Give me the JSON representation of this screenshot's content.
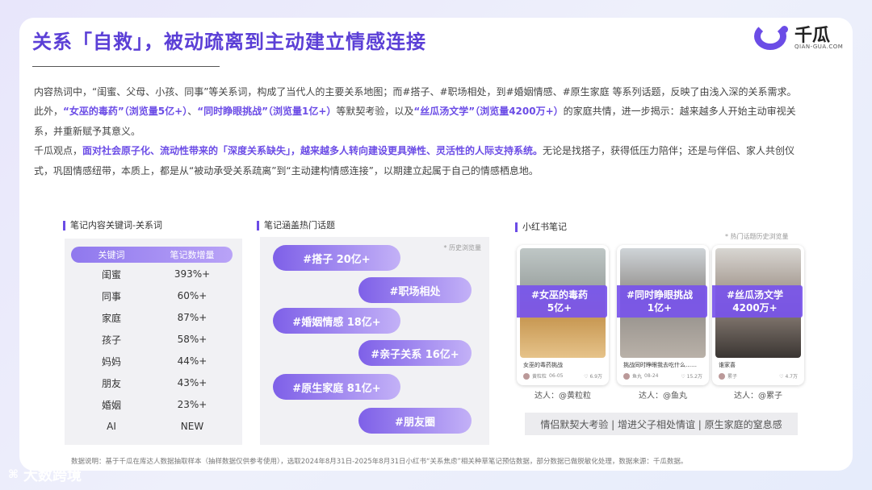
{
  "header": {
    "title": "关系「自救」，被动疏离到主动建立情感连接",
    "brand_name": "千瓜",
    "brand_sub": "QIAN-GUA.COM"
  },
  "intro": {
    "p1_a": "内容热词中，“闺蜜、父母、小孩、同事”等关系词，构成了当代人的主要关系地图；而#搭子、#职场相处，到#婚姻情感、#原生家庭 等系列话题，反映了由浅入深的关系需求。此外，",
    "p1_h1": "“女巫的毒药”（浏览量5亿+）",
    "p1_b": "、",
    "p1_h2": "“同时睁眼挑战”（浏览量1亿+）",
    "p1_c": "等默契考验，以及",
    "p1_h3": "“丝瓜汤文学”（浏览量4200万+）",
    "p1_d": "的家庭共情，进一步揭示：越来越多人开始主动审视关系，并重新赋予其意义。",
    "p2_a": "千瓜观点，",
    "p2_h": "面对社会原子化、流动性带来的「深度关系缺失」，越来越多人转向建设更具弹性、灵活性的人际支持系统。",
    "p2_b": "无论是找搭子，获得低压力陪伴；还是与伴侣、家人共创仪式，巩固情感纽带，本质上，都是从“被动承受关系疏离”到“主动建构情感连接”，以期建立起属于自己的情感栖息地。"
  },
  "keywords": {
    "label": "笔记内容关键词-关系词",
    "col1": "关键词",
    "col2": "笔记数增量",
    "rows": [
      {
        "k": "闺蜜",
        "v": "393%+"
      },
      {
        "k": "同事",
        "v": "60%+"
      },
      {
        "k": "家庭",
        "v": "87%+"
      },
      {
        "k": "孩子",
        "v": "58%+"
      },
      {
        "k": "妈妈",
        "v": "44%+"
      },
      {
        "k": "朋友",
        "v": "43%+"
      },
      {
        "k": "婚姻",
        "v": "23%+"
      },
      {
        "k": "AI",
        "v": "NEW"
      }
    ]
  },
  "topics": {
    "label": "笔记涵盖热门话题",
    "note": "* 历史浏览量",
    "items": [
      "#搭子 20亿+",
      "#职场相处",
      "#婚姻情感 18亿+",
      "#亲子关系 16亿+",
      "#原生家庭 81亿+",
      "#朋友圈"
    ]
  },
  "xhs": {
    "label": "小红书笔记",
    "note": "* 热门话题历史浏览量",
    "cards": [
      {
        "tag1": "#女巫的毒药",
        "tag2": "5亿+",
        "caption": "女巫的毒药挑战",
        "user": "黄粒粒",
        "date": "06-05",
        "likes": "6.9万",
        "talent": "达人：@黄粒粒"
      },
      {
        "tag1": "#同时睁眼挑战",
        "tag2": "1亿+",
        "caption": "挑战同时睁眼我去吃什么……",
        "user": "鱼丸",
        "date": "08-24",
        "likes": "15.2万",
        "talent": "达人：@鱼丸"
      },
      {
        "tag1": "#丝瓜汤文学",
        "tag2": "4200万+",
        "caption": "谁家喜",
        "user": "累子",
        "date": "",
        "likes": "4.7万",
        "talent": "达人：@累子"
      }
    ],
    "summary": "情侣默契大考验 | 增进父子相处情谊 | 原生家庭的窒息感"
  },
  "footer": {
    "text": "数据说明：基于千瓜在库达人数据抽取样本（抽样数据仅供参考使用），选取2024年8月31日-2025年8月31日小红书“关系焦虑”相关种草笔记预估数据，部分数据已做脱敏化处理，数据来源：千瓜数据。",
    "watermark": "大数跨境"
  },
  "colors": {
    "accent": "#6b4ce6",
    "panel": "#f1f1f4"
  }
}
